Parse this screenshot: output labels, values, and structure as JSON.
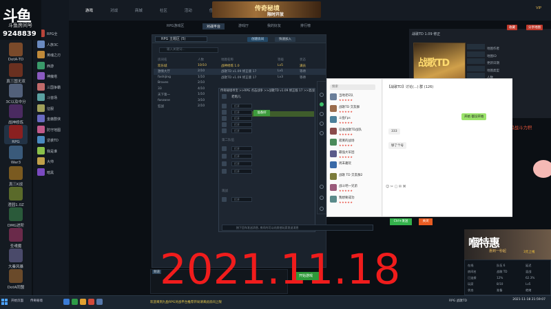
{
  "overlay": {
    "logo": "斗鱼",
    "logo_sub": "斗鱼房间号",
    "room_id": "9248839",
    "date": "2021.11.18"
  },
  "platform": {
    "top_tabs": [
      "游戏",
      "对战",
      "商城",
      "社区",
      "活动",
      "任务",
      "好友",
      "比赛"
    ],
    "banner_title": "传奇秘境",
    "banner_sub": "限时开放",
    "top_right": "VIP"
  },
  "left_games": [
    {
      "label": "DotA-TD",
      "color": "#7a4a2a"
    },
    {
      "label": "真三国无双",
      "color": "#6a3020"
    },
    {
      "label": "3C以及中分",
      "color": "#52607a"
    },
    {
      "label": "战神修炼",
      "color": "#4a2a60"
    },
    {
      "label": "RPG",
      "color": "#8a2020"
    },
    {
      "label": "War3",
      "color": "#3a5a7a"
    },
    {
      "label": "真三K战",
      "color": "#7a5a20"
    },
    {
      "label": "澄园1.0Z",
      "color": "#5a6a2a"
    },
    {
      "label": "DMG进阶",
      "color": "#2a5a3a"
    },
    {
      "label": "圣魂魔",
      "color": "#6a2a4a"
    },
    {
      "label": "大秦风暴",
      "color": "#4a4a6a"
    },
    {
      "label": "DotA同盟",
      "color": "#6a4a2a"
    }
  ],
  "secondary_games": [
    "RPG全",
    "人族3C",
    "英魂之刃",
    "西游",
    "神魔塔",
    "三国争霸",
    "斗兽场",
    "征服",
    "金庸群侠",
    "防守地图",
    "逆袭TD",
    "我是谁",
    "大帅",
    "暗黑"
  ],
  "room_tabs": [
    "RPG游戏区",
    "对战平台",
    "游戏厅",
    "我的好友",
    "排行榜"
  ],
  "room_panel": {
    "region": "RPG 主题区 (5)",
    "search_placeholder": "输入关键词...",
    "create_button": "创建房间",
    "quick_button": "快速加入",
    "headers": [
      "房间名",
      "人数",
      "地图名称",
      "等级",
      "状态"
    ],
    "rows": [
      {
        "name": "欢乐城",
        "count": "10/10",
        "map": "战神修炼 1.0",
        "level": "Lv5",
        "status": "满员"
      },
      {
        "name": "激情大厅",
        "count": "2/10",
        "map": "战歌TD v1.09 修正版 17",
        "level": "Lv1",
        "status": "等待"
      },
      {
        "name": "fashijing",
        "count": "1/10",
        "map": "战歌TD v1.09 修正版 17",
        "level": "Lv3",
        "status": "等待"
      },
      {
        "name": "Braves",
        "count": "2/10",
        "map": "",
        "level": "",
        "status": ""
      },
      {
        "name": "33",
        "count": "4/10",
        "map": "",
        "level": "",
        "status": ""
      },
      {
        "name": "天下第一",
        "count": "1/10",
        "map": "",
        "level": "",
        "status": ""
      },
      {
        "name": "fanzone",
        "count": "3/10",
        "map": "",
        "level": "",
        "status": ""
      },
      {
        "name": "狂战",
        "count": "2/10",
        "map": "",
        "level": "",
        "status": ""
      }
    ]
  },
  "game_room": {
    "title": "传奇秘境寻宝 >>RPG 点击战争 >>战歌TD v1.09 修正版 17 >>混战经典模式",
    "host": "老炮儿",
    "slots": [
      "打开",
      "打开",
      "打开",
      "打开",
      "打开"
    ],
    "team2_header": "第二队伍",
    "team2_slots": [
      "打开",
      "打开",
      "打开",
      "打开"
    ],
    "obs_header": "观战",
    "obs_slot": "打开",
    "ready_label": "准备好",
    "input_placeholder": "按下回车发送消息, 房间内可以向其他玩家发送消息"
  },
  "start_area": {
    "label": "频道",
    "start_button": "开始游戏"
  },
  "right_panel": {
    "header": "战歌TD 1.09 修正",
    "btn1": "收藏",
    "btn2": "分享地图",
    "card": "战歌TD",
    "info": [
      "地图作者",
      "地图ID",
      "更新日期",
      "地图类型",
      "人数",
      "下载量",
      "游戏时长"
    ],
    "red_text": "和战斗力积"
  },
  "chat": {
    "search": "搜索",
    "title": "【战歌TD】讨论(...) 群 (126)",
    "contacts": [
      {
        "name": "当地老E队",
        "stars": "★★★★★",
        "color": "#6b7f9a"
      },
      {
        "name": "战歌TD 交友群",
        "stars": "★★★★★",
        "color": "#9a6b4b"
      },
      {
        "name": "斗鱼Fps",
        "stars": "★★★★★",
        "color": "#4b7f9a"
      },
      {
        "name": "征收战歌TD战队",
        "stars": "★★★★★",
        "color": "#8a4a4a"
      },
      {
        "name": "寂寞的战场",
        "stars": "★★★★★",
        "color": "#4a8a5a"
      },
      {
        "name": "最强大军团",
        "stars": "★★★★★",
        "color": "#5a5a8a"
      },
      {
        "name": "周末趣玩",
        "stars": "",
        "color": "#3a6aa8"
      },
      {
        "name": "战歌 TD 交友群2",
        "stars": "",
        "color": "#7a7a3a"
      },
      {
        "name": "战斗吧一兄弟",
        "stars": "★★★★★",
        "color": "#9a5a7a"
      },
      {
        "name": "我想要成功",
        "stars": "★★★★★",
        "color": "#5a8a8a"
      }
    ],
    "msg_right": "开始 都没开始",
    "msg_left1": "333",
    "msg_left2": "够了个号",
    "send": "Ctrl+发送",
    "close": "关闭"
  },
  "streamer": {
    "cam_big": "嗰特惠",
    "cam_small": "惠到一秒起",
    "cam_label": "3元上线",
    "status_rows": [
      {
        "left": "在线",
        "mid": "队伍 6",
        "right": "延迟"
      },
      {
        "left": "房间名",
        "mid": "战歌 TD",
        "right": "混战"
      },
      {
        "left": "已连接",
        "mid": "12%",
        "right": "62.3%"
      },
      {
        "left": "玩家",
        "mid": "8/10",
        "right": "Lv5"
      },
      {
        "left": "状态",
        "mid": "准备",
        "right": "就绪"
      }
    ]
  },
  "taskbar": {
    "apps": [
      "开始页面",
      "传奇秘境"
    ],
    "notice": "欢迎来到九鱼RPG对战平台推荐开局请来此房间上限",
    "time": "2021-11-18 21:59:07",
    "tray": "RPG 战歌TD"
  }
}
